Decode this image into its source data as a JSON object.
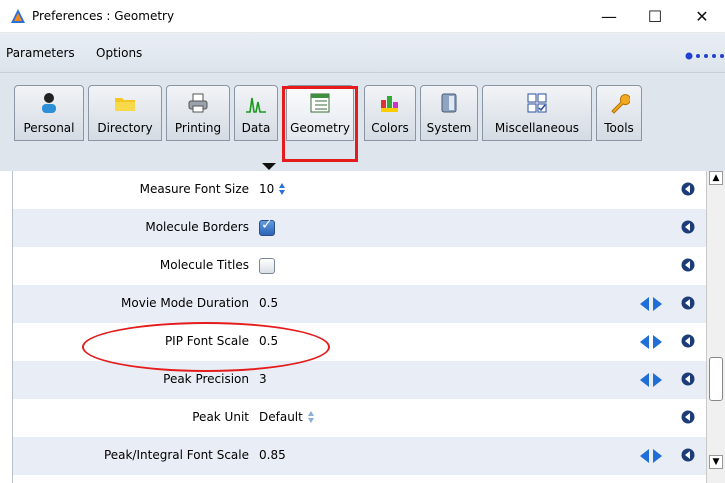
{
  "window": {
    "title": "Preferences : Geometry",
    "minimize_glyph": "—",
    "maximize_glyph": "☐",
    "close_glyph": "✕"
  },
  "menu": {
    "parameters": "Parameters",
    "options": "Options"
  },
  "tabs": [
    {
      "label": "Personal",
      "icon": "person-icon"
    },
    {
      "label": "Directory",
      "icon": "folder-icon"
    },
    {
      "label": "Printing",
      "icon": "printer-icon"
    },
    {
      "label": "Data",
      "icon": "spectrum-icon"
    },
    {
      "label": "Geometry",
      "icon": "geometry-icon",
      "selected": true
    },
    {
      "label": "Colors",
      "icon": "colors-icon"
    },
    {
      "label": "System",
      "icon": "system-icon"
    },
    {
      "label": "Miscellaneous",
      "icon": "miscellaneous-icon"
    },
    {
      "label": "Tools",
      "icon": "wrench-icon"
    }
  ],
  "rows": [
    {
      "label": "Measure Font Size",
      "value": "10",
      "control": "spinner"
    },
    {
      "label": "Molecule Borders",
      "value": "",
      "control": "checkbox",
      "checked": true
    },
    {
      "label": "Molecule Titles",
      "value": "",
      "control": "checkbox",
      "checked": false
    },
    {
      "label": "Movie Mode Duration",
      "value": "0.5",
      "control": "slider"
    },
    {
      "label": "PIP Font Scale",
      "value": "0.5",
      "control": "slider"
    },
    {
      "label": "Peak Precision",
      "value": "3",
      "control": "slider"
    },
    {
      "label": "Peak Unit",
      "value": "Default",
      "control": "dropdown"
    },
    {
      "label": "Peak/Integral Font Scale",
      "value": "0.85",
      "control": "slider"
    }
  ],
  "colors": {
    "annotation_red": "#e41c1c",
    "row_alt": "#e9eef6",
    "accent_blue": "#1f6fd6"
  }
}
